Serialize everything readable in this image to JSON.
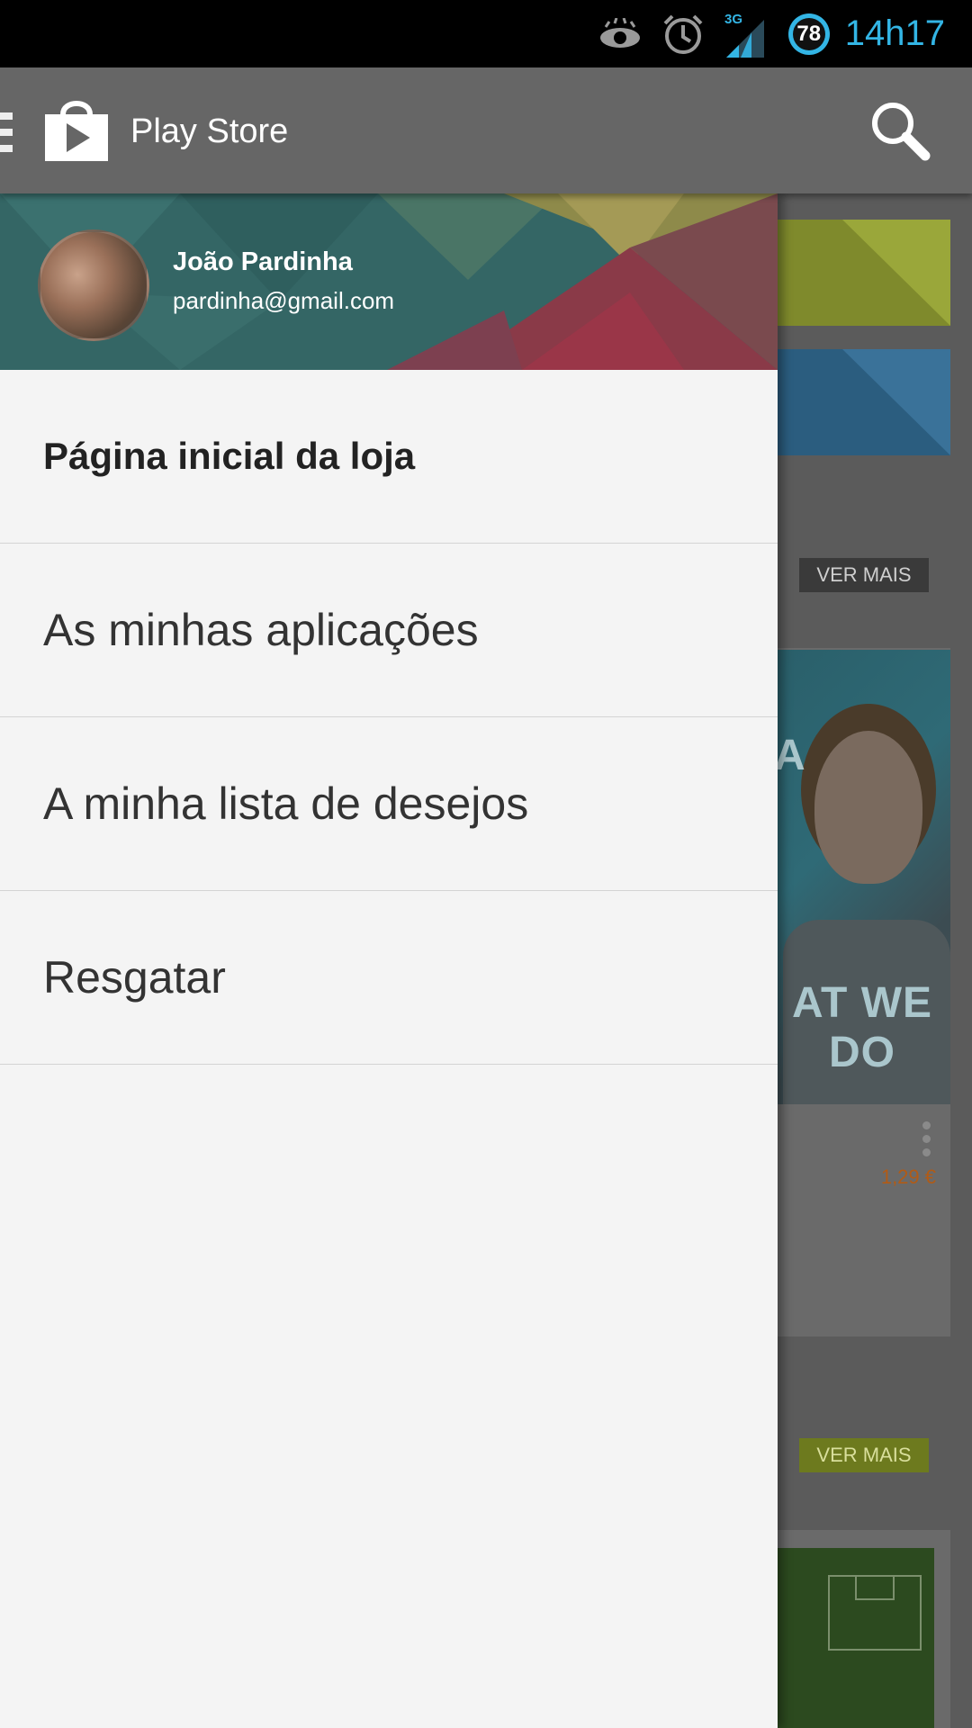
{
  "status_bar": {
    "time": "14h17",
    "battery_level": "78",
    "network": "3G",
    "accent_color": "#33b5e5",
    "icons": [
      "eye-icon",
      "alarm-icon",
      "signal-3g-icon",
      "battery-icon"
    ]
  },
  "action_bar": {
    "title": "Play Store",
    "icons": [
      "menu-icon",
      "play-store-icon",
      "search-icon"
    ]
  },
  "drawer": {
    "user": {
      "name": "João Pardinha",
      "email": "pardinha@gmail.com"
    },
    "items": [
      {
        "label": "Página inicial da loja",
        "selected": true
      },
      {
        "label": "As minhas aplicações",
        "selected": false
      },
      {
        "label": "A minha lista de desejos",
        "selected": false
      },
      {
        "label": "Resgatar",
        "selected": false
      }
    ]
  },
  "background": {
    "see_more_1": "VER MAIS",
    "see_more_2": "VER MAIS",
    "poster_text": "AT WE DO",
    "poster_letter": "A",
    "price": "1,29 €"
  }
}
